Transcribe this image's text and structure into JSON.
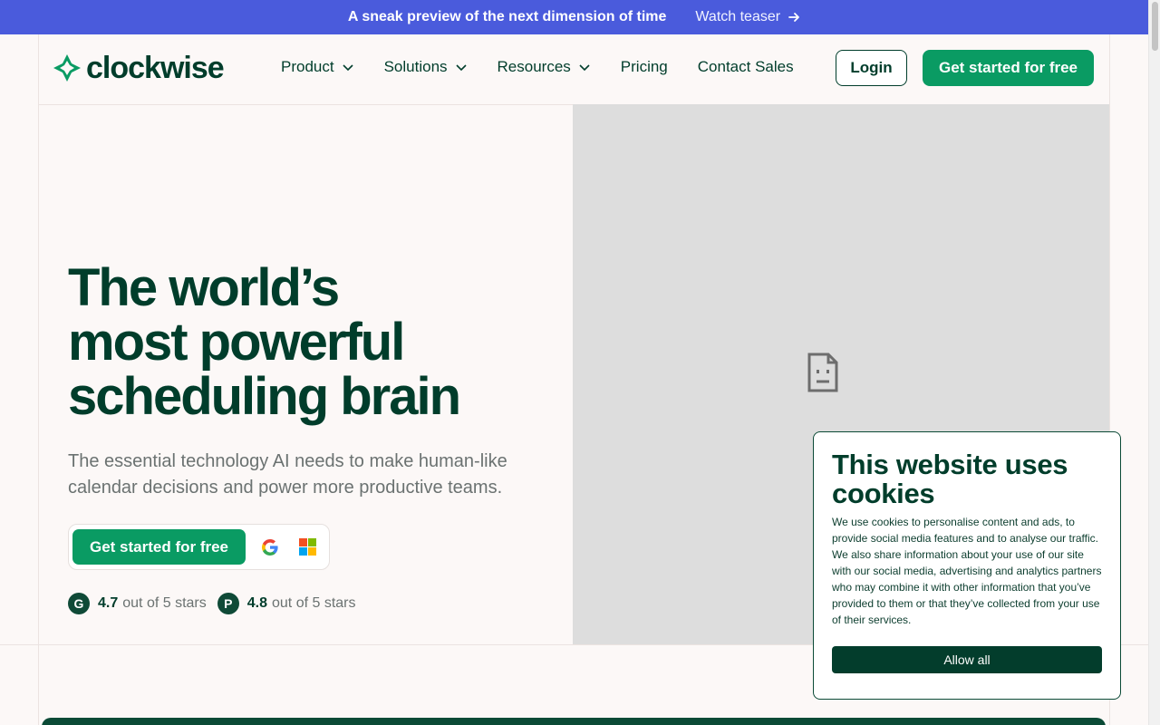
{
  "announcement": {
    "message": "A sneak preview of the next dimension of time",
    "link_label": "Watch teaser"
  },
  "nav": {
    "logo_text": "clockwise",
    "items": [
      {
        "label": "Product",
        "has_dropdown": true
      },
      {
        "label": "Solutions",
        "has_dropdown": true
      },
      {
        "label": "Resources",
        "has_dropdown": true
      },
      {
        "label": "Pricing",
        "has_dropdown": false
      },
      {
        "label": "Contact Sales",
        "has_dropdown": false
      }
    ],
    "login_label": "Login",
    "cta_label": "Get started for free"
  },
  "hero": {
    "title_lines": [
      "The world’s",
      "most powerful",
      "scheduling brain"
    ],
    "subtitle": "The essential technology AI needs to make human-like calendar decisions and power more productive teams.",
    "cta_label": "Get started for free",
    "ratings": [
      {
        "badge": "G",
        "badge_icon": "g2-icon",
        "score": "4.7",
        "suffix": "out of 5 stars"
      },
      {
        "badge": "P",
        "badge_icon": "producthunt-icon",
        "score": "4.8",
        "suffix": "out of 5 stars"
      }
    ]
  },
  "cookie": {
    "title": "This website uses cookies",
    "body": "We use cookies to personalise content and ads, to provide social media features and to analyse our traffic. We also share information about your use of our site with our social media, advertising and analytics partners who may combine it with other information that you’ve provided to them or that they’ve collected from your use of their services.",
    "allow_label": "Allow all"
  },
  "colors": {
    "brand_green": "#0a9b63",
    "dark_green": "#003d2b",
    "announce_blue": "#4a5bdc"
  }
}
